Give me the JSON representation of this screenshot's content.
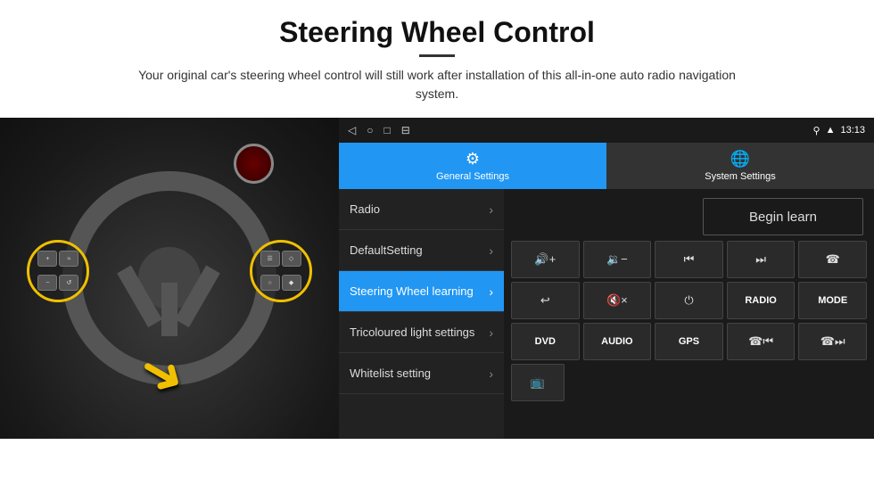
{
  "page": {
    "title": "Steering Wheel Control",
    "subtitle": "Your original car's steering wheel control will still work after installation of this all-in-one auto radio navigation system."
  },
  "status_bar": {
    "time": "13:13",
    "icons": [
      "◁",
      "○",
      "□",
      "⊟"
    ]
  },
  "tabs": [
    {
      "id": "general",
      "label": "General Settings",
      "active": true
    },
    {
      "id": "system",
      "label": "System Settings",
      "active": false
    }
  ],
  "menu_items": [
    {
      "id": "radio",
      "label": "Radio",
      "active": false
    },
    {
      "id": "default",
      "label": "DefaultSetting",
      "active": false
    },
    {
      "id": "steering",
      "label": "Steering Wheel learning",
      "active": true
    },
    {
      "id": "tricoloured",
      "label": "Tricoloured light settings",
      "active": false
    },
    {
      "id": "whitelist",
      "label": "Whitelist setting",
      "active": false
    }
  ],
  "controls": {
    "begin_learn_label": "Begin learn",
    "buttons_row1": [
      {
        "id": "vol_up",
        "type": "icon",
        "label": "🔊+",
        "symbol": "🔊+"
      },
      {
        "id": "vol_down",
        "type": "icon",
        "label": "🔉-",
        "symbol": "🔉-"
      },
      {
        "id": "prev",
        "type": "icon",
        "label": "⏮",
        "symbol": "⏮"
      },
      {
        "id": "next",
        "type": "icon",
        "label": "⏭",
        "symbol": "⏭"
      },
      {
        "id": "phone",
        "type": "icon",
        "label": "📞",
        "symbol": "☎"
      }
    ],
    "buttons_row2": [
      {
        "id": "call_end",
        "type": "icon",
        "label": "↩",
        "symbol": "↩"
      },
      {
        "id": "mute",
        "type": "icon",
        "label": "🔇×",
        "symbol": "🔇×"
      },
      {
        "id": "power",
        "type": "icon",
        "label": "⏻",
        "symbol": "⏻"
      },
      {
        "id": "radio_btn",
        "type": "text",
        "label": "RADIO",
        "symbol": "RADIO"
      },
      {
        "id": "mode_btn",
        "type": "text",
        "label": "MODE",
        "symbol": "MODE"
      }
    ],
    "buttons_row3": [
      {
        "id": "dvd_btn",
        "type": "text",
        "label": "DVD",
        "symbol": "DVD"
      },
      {
        "id": "audio_btn",
        "type": "text",
        "label": "AUDIO",
        "symbol": "AUDIO"
      },
      {
        "id": "gps_btn",
        "type": "text",
        "label": "GPS",
        "symbol": "GPS"
      },
      {
        "id": "phone_prev",
        "type": "icon",
        "label": "☎⏮",
        "symbol": "☎⏮"
      },
      {
        "id": "phone_next",
        "type": "icon",
        "label": "☎⏭",
        "symbol": "☎⏭"
      }
    ]
  }
}
